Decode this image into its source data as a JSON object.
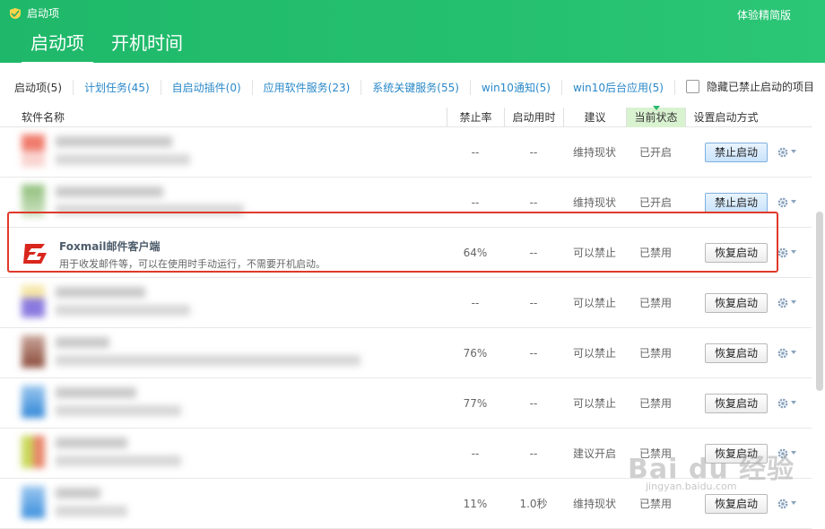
{
  "header": {
    "app_title": "启动项",
    "edition_label": "体验精简版",
    "tabs": [
      {
        "label": "启动项",
        "active": true
      },
      {
        "label": "开机时间",
        "active": false
      }
    ]
  },
  "filters": {
    "items": [
      {
        "label": "启动项(5)"
      },
      {
        "label": "计划任务(45)"
      },
      {
        "label": "自启动插件(0)"
      },
      {
        "label": "应用软件服务(23)"
      },
      {
        "label": "系统关键服务(55)"
      },
      {
        "label": "win10通知(5)"
      },
      {
        "label": "win10后台应用(5)"
      }
    ],
    "hide_disabled_label": "隐藏已禁止启动的项目",
    "hide_disabled_checked": false
  },
  "columns": {
    "name": "软件名称",
    "rate": "禁止率",
    "time": "启动用时",
    "suggestion": "建议",
    "state": "当前状态",
    "method": "设置启动方式"
  },
  "rows": [
    {
      "blurred": true,
      "rate": "--",
      "time": "--",
      "suggestion": "维持现状",
      "state": "已开启",
      "action": "禁止启动",
      "action_style": "blue"
    },
    {
      "blurred": true,
      "rate": "--",
      "time": "--",
      "suggestion": "维持现状",
      "state": "已开启",
      "action": "禁止启动",
      "action_style": "blue"
    },
    {
      "blurred": false,
      "name": "Foxmail邮件客户端",
      "desc": "用于收发邮件等，可以在使用时手动运行，不需要开机启动。",
      "rate": "64%",
      "time": "--",
      "suggestion": "可以禁止",
      "state": "已禁用",
      "action": "恢复启动",
      "action_style": "gray"
    },
    {
      "blurred": true,
      "rate": "--",
      "time": "--",
      "suggestion": "可以禁止",
      "state": "已禁用",
      "action": "恢复启动",
      "action_style": "gray"
    },
    {
      "blurred": true,
      "rate": "76%",
      "time": "--",
      "suggestion": "可以禁止",
      "state": "已禁用",
      "action": "恢复启动",
      "action_style": "gray"
    },
    {
      "blurred": true,
      "rate": "77%",
      "time": "--",
      "suggestion": "可以禁止",
      "state": "已禁用",
      "action": "恢复启动",
      "action_style": "gray"
    },
    {
      "blurred": true,
      "rate": "--",
      "time": "--",
      "suggestion": "建议开启",
      "state": "已禁用",
      "action": "恢复启动",
      "action_style": "gray"
    },
    {
      "blurred": true,
      "rate": "11%",
      "time": "1.0秒",
      "suggestion": "维持现状",
      "state": "已禁用",
      "action": "恢复启动",
      "action_style": "gray"
    }
  ],
  "watermark": {
    "text": "Bai du 经验",
    "sub": "jingyan.baidu.com"
  },
  "colors": {
    "header_green": "#25c06f",
    "link_blue": "#2a88c9",
    "highlight_red": "#e0392a",
    "current_col_bg": "#d9f2d0"
  }
}
